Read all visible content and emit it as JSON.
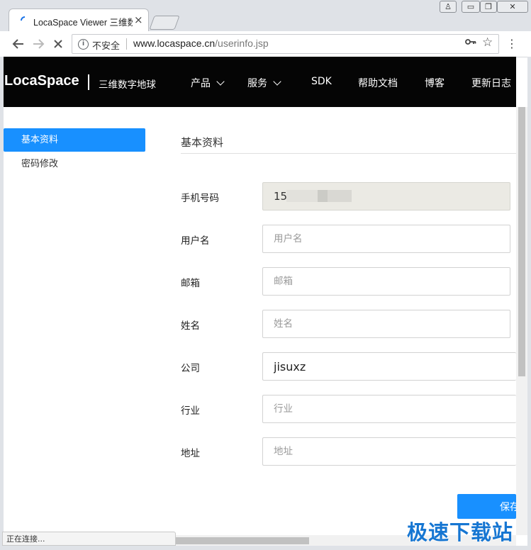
{
  "browser": {
    "tab_title": "LocaSpace Viewer 三维数字地球",
    "tab_close": "×",
    "window_buttons": [
      "♙",
      "▭",
      "❐",
      "✕"
    ],
    "security_label": "不安全",
    "url_host": "www.locaspace.cn",
    "url_path": "/userinfo.jsp",
    "status_text": "正在连接..."
  },
  "header": {
    "logo": "LocaSpace",
    "tagline": "三维数字地球",
    "nav": [
      "产品",
      "服务",
      "SDK",
      "帮助文档",
      "博客",
      "更新日志"
    ]
  },
  "sidebar": {
    "items": [
      "基本资料",
      "密码修改"
    ]
  },
  "form": {
    "title": "基本资料",
    "fields": [
      {
        "label": "手机号码",
        "value": "15",
        "placeholder": ""
      },
      {
        "label": "用户名",
        "value": "",
        "placeholder": "用户名"
      },
      {
        "label": "邮箱",
        "value": "",
        "placeholder": "邮箱"
      },
      {
        "label": "姓名",
        "value": "",
        "placeholder": "姓名"
      },
      {
        "label": "公司",
        "value": "jisuxz",
        "placeholder": ""
      },
      {
        "label": "行业",
        "value": "",
        "placeholder": "行业"
      },
      {
        "label": "地址",
        "value": "",
        "placeholder": "地址"
      }
    ],
    "save_label": "保存"
  },
  "watermark": "极速下载站",
  "colors": {
    "accent": "#1890ff",
    "header_bg": "#050505",
    "disabled_bg": "#ebeae4"
  }
}
